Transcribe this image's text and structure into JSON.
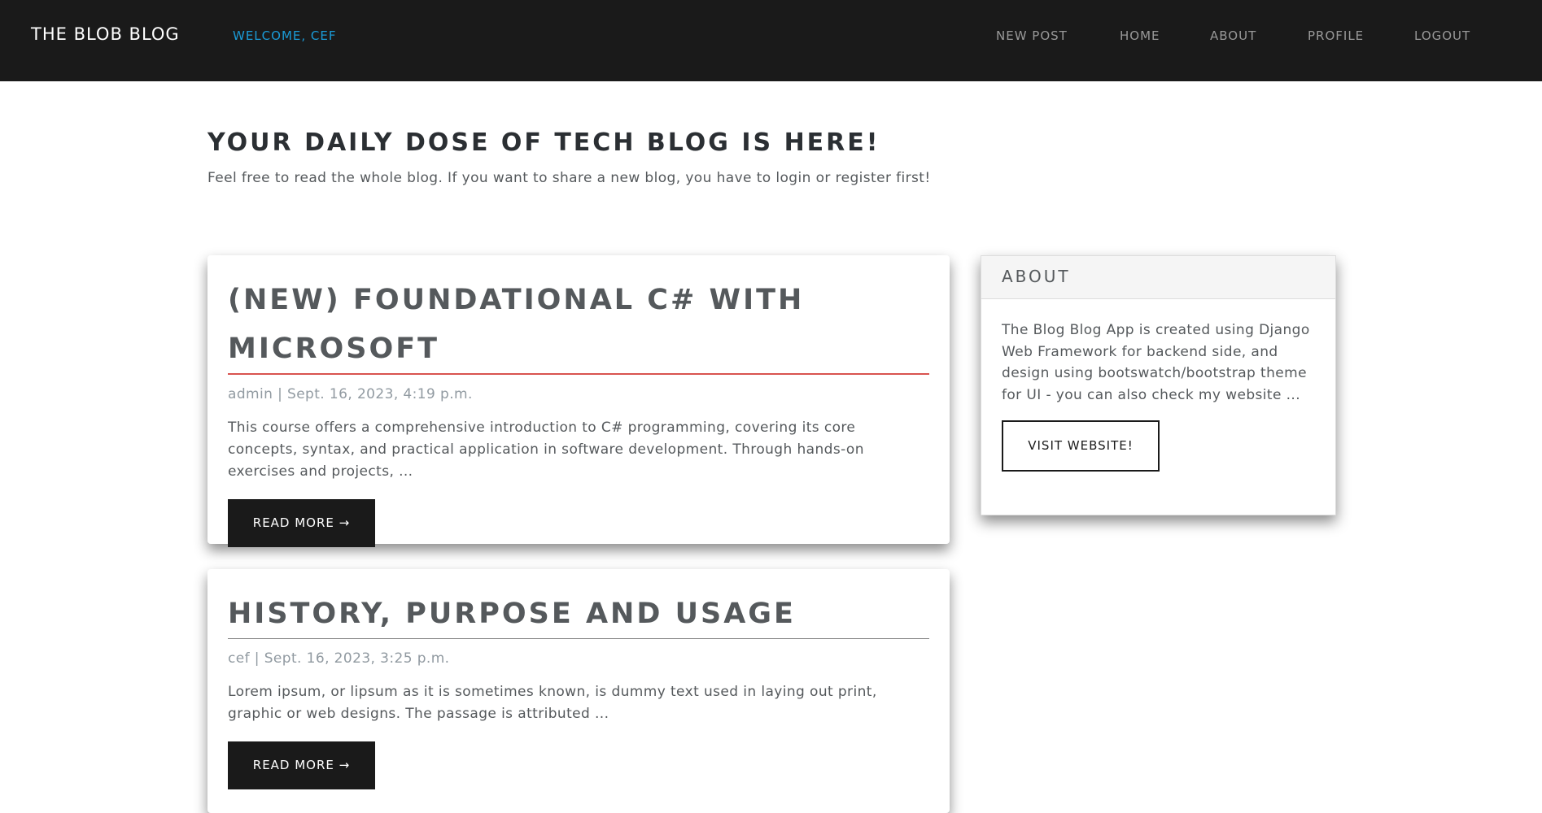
{
  "navbar": {
    "brand": "THE BLOB BLOG",
    "welcome": "WELCOME, CEF",
    "links": [
      "NEW POST",
      "HOME",
      "ABOUT",
      "PROFILE",
      "LOGOUT"
    ]
  },
  "hero": {
    "title": "YOUR DAILY DOSE OF TECH BLOG IS HERE!",
    "subtitle": "Feel free to read the whole blog. If you want to share a new blog, you have to login or register first!"
  },
  "posts": [
    {
      "title": "(NEW) FOUNDATIONAL C# WITH MICROSOFT",
      "meta": "admin | Sept. 16, 2023, 4:19 p.m.",
      "excerpt": "This course offers a comprehensive introduction to C# programming, covering its core concepts, syntax, and practical application in software development. Through hands-on exercises and projects, ...",
      "button": "READ MORE →"
    },
    {
      "title": "HISTORY, PURPOSE AND USAGE",
      "meta": "cef | Sept. 16, 2023, 3:25 p.m.",
      "excerpt": "Lorem ipsum, or lipsum as it is sometimes known, is dummy text used in laying out print, graphic or web designs. The passage is attributed ...",
      "button": "READ MORE →"
    }
  ],
  "sidebar": {
    "title": "ABOUT",
    "text": "The Blog Blog App is created using Django Web Framework for backend side, and design using bootswatch/bootstrap theme for UI - you can also check my website ...",
    "button": "VISIT WEBSITE!"
  },
  "colors": {
    "navbar": "#1a1a1a",
    "welcome": "#1a9bd7",
    "accent_underline": "#d9534f"
  }
}
